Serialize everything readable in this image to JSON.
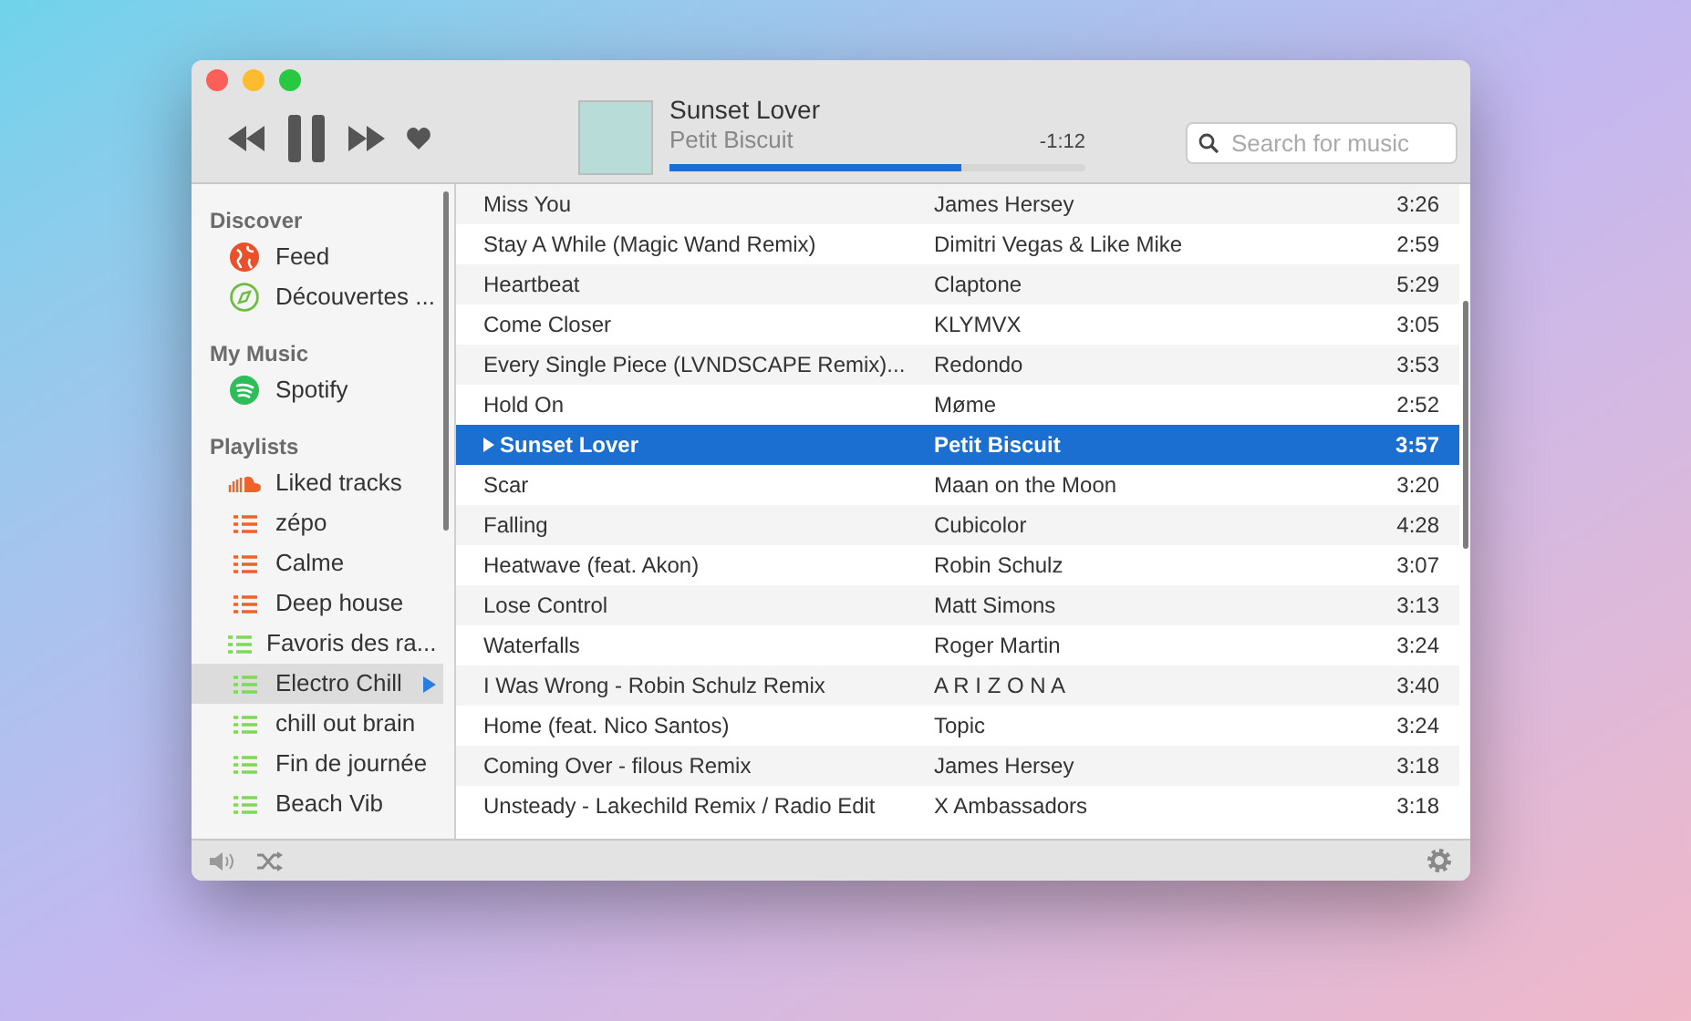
{
  "player": {
    "title": "Sunset Lover",
    "artist": "Petit Biscuit",
    "remaining": "-1:12",
    "level": 0.7
  },
  "search": {
    "placeholder": "Search for music"
  },
  "sidebar": {
    "sections": [
      {
        "heading": "Discover",
        "items": [
          {
            "label": "Feed",
            "kind": "globe",
            "selected": false
          },
          {
            "label": "Découvertes ...",
            "kind": "compass",
            "selected": false
          }
        ]
      },
      {
        "heading": "My Music",
        "items": [
          {
            "label": "Spotify",
            "kind": "spotify",
            "selected": false
          }
        ]
      },
      {
        "heading": "Playlists",
        "items": [
          {
            "label": "Liked tracks",
            "kind": "cloud",
            "selected": false
          },
          {
            "label": "zépo",
            "kind": "playlist",
            "color": "#f0622b",
            "selected": false
          },
          {
            "label": "Calme",
            "kind": "playlist",
            "color": "#f0622b",
            "selected": false
          },
          {
            "label": "Deep house",
            "kind": "playlist",
            "color": "#f0622b",
            "selected": false
          },
          {
            "label": "Favoris des ra...",
            "kind": "playlist",
            "color": "#7ed957",
            "selected": false
          },
          {
            "label": "Electro Chill",
            "kind": "playlist",
            "color": "#7ed957",
            "selected": true
          },
          {
            "label": "chill out brain",
            "kind": "playlist",
            "color": "#7ed957",
            "selected": false
          },
          {
            "label": "Fin de journée",
            "kind": "playlist",
            "color": "#7ed957",
            "selected": false
          },
          {
            "label": "Beach Vib",
            "kind": "playlist",
            "color": "#7ed957",
            "selected": false
          }
        ]
      }
    ]
  },
  "tracks": [
    {
      "title": "Miss You",
      "artist": "James Hersey",
      "duration": "3:26",
      "selected": false
    },
    {
      "title": "Stay A While (Magic Wand Remix)",
      "artist": "Dimitri Vegas & Like Mike",
      "duration": "2:59",
      "selected": false
    },
    {
      "title": "Heartbeat",
      "artist": "Claptone",
      "duration": "5:29",
      "selected": false
    },
    {
      "title": "Come Closer",
      "artist": "KLYMVX",
      "duration": "3:05",
      "selected": false
    },
    {
      "title": "Every Single Piece (LVNDSCAPE Remix)...",
      "artist": "Redondo",
      "duration": "3:53",
      "selected": false
    },
    {
      "title": "Hold On",
      "artist": "Møme",
      "duration": "2:52",
      "selected": false
    },
    {
      "title": "Sunset Lover",
      "artist": "Petit Biscuit",
      "duration": "3:57",
      "selected": true
    },
    {
      "title": "Scar",
      "artist": "Maan on the Moon",
      "duration": "3:20",
      "selected": false
    },
    {
      "title": "Falling",
      "artist": "Cubicolor",
      "duration": "4:28",
      "selected": false
    },
    {
      "title": "Heatwave (feat. Akon)",
      "artist": "Robin Schulz",
      "duration": "3:07",
      "selected": false
    },
    {
      "title": "Lose Control",
      "artist": "Matt Simons",
      "duration": "3:13",
      "selected": false
    },
    {
      "title": "Waterfalls",
      "artist": "Roger Martin",
      "duration": "3:24",
      "selected": false
    },
    {
      "title": "I Was Wrong - Robin Schulz Remix",
      "artist": "A R I Z O N A",
      "duration": "3:40",
      "selected": false
    },
    {
      "title": "Home (feat. Nico Santos)",
      "artist": "Topic",
      "duration": "3:24",
      "selected": false
    },
    {
      "title": "Coming Over - filous Remix",
      "artist": "James Hersey",
      "duration": "3:18",
      "selected": false
    },
    {
      "title": "Unsteady - Lakechild Remix / Radio Edit",
      "artist": "X Ambassadors",
      "duration": "3:18",
      "selected": false
    }
  ]
}
